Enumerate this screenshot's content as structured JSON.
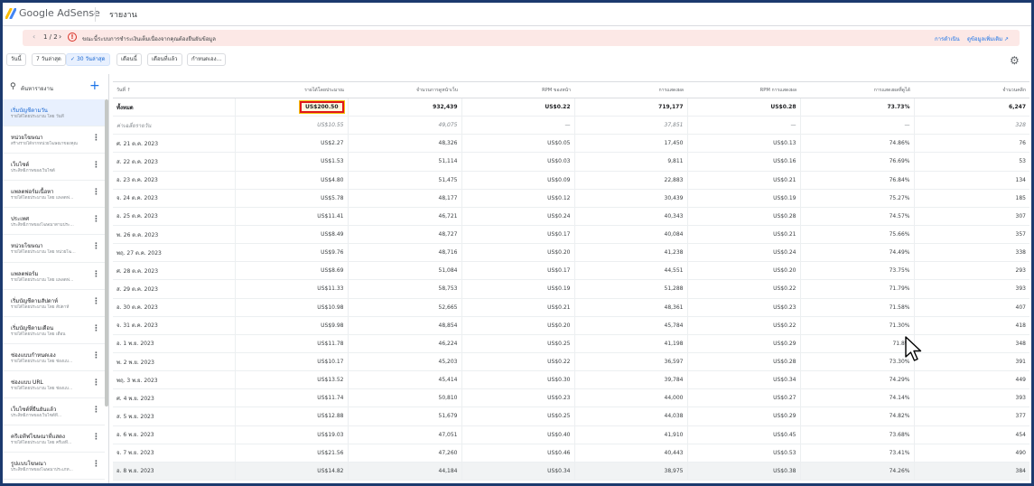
{
  "app": {
    "brand": "Google AdSense",
    "page_title": "รายงาน"
  },
  "alert": {
    "counter": "1 / 2",
    "message": "ขณะนี้ระบบการชำระเงินเต็มเนื่องจากคุณต้องยืนยันข้อมูล",
    "action_1": "การดำเนิน",
    "action_2": "ดูข้อมูลเพิ่มเติม ↗",
    "colors": {
      "background": "#fce8e6",
      "icon": "#d93025",
      "link": "#1a73e8"
    }
  },
  "date_chips": [
    {
      "label": "วันนี้",
      "selected": false
    },
    {
      "label": "7 วันล่าสุด",
      "selected": false
    },
    {
      "label": "30 วันล่าสุด",
      "selected": true
    },
    {
      "label": "เดือนนี้",
      "selected": false
    },
    {
      "label": "เดือนที่แล้ว",
      "selected": false
    },
    {
      "label": "กำหนดเอง...",
      "selected": false
    }
  ],
  "sidebar": {
    "search_label": "ค้นหารายงาน",
    "add_icon": "plus-icon",
    "reports": [
      {
        "title": "เริ่มบัญชีตามวัน",
        "subtitle": "รายได้โดยประมาณ โดย วันที่",
        "active": true
      },
      {
        "title": "หน่วยโฆษณา",
        "subtitle": "สร้างรายได้จากหน่วยโฆษณาของคุณ",
        "active": false
      },
      {
        "title": "เว็บไซต์",
        "subtitle": "ประสิทธิภาพของเว็บไซต์",
        "active": false
      },
      {
        "title": "แพลตฟอร์มเนื้อหา",
        "subtitle": "รายได้โดยประมาณ โดย แพลตฟ...",
        "active": false
      },
      {
        "title": "ประเทศ",
        "subtitle": "ประสิทธิภาพของโฆษณาตามประ...",
        "active": false
      },
      {
        "title": "หน่วยโฆษณา",
        "subtitle": "รายได้โดยประมาณ โดย หน่วยโฆ...",
        "active": false
      },
      {
        "title": "แพลตฟอร์ม",
        "subtitle": "รายได้โดยประมาณ โดย แพลตฟ...",
        "active": false
      },
      {
        "title": "เริ่มบัญชีตามสัปดาห์",
        "subtitle": "รายได้โดยประมาณ โดย สัปดาห์",
        "active": false
      },
      {
        "title": "เริ่มบัญชีตามเดือน",
        "subtitle": "รายได้โดยประมาณ โดย เดือน",
        "active": false
      },
      {
        "title": "ช่องแบบกำหนดเอง",
        "subtitle": "รายได้โดยประมาณ โดย ช่องแบ...",
        "active": false
      },
      {
        "title": "ช่องแบบ URL",
        "subtitle": "รายได้โดยประมาณ โดย ช่องแบ...",
        "active": false
      },
      {
        "title": "เว็บไซต์ที่ยืนยันแล้ว",
        "subtitle": "ประสิทธิภาพของเว็บไซต์ที่...",
        "active": false
      },
      {
        "title": "ครีเอทีฟโฆษณาที่แสดง",
        "subtitle": "รายได้โดยประมาณ โดย ครีเอที...",
        "active": false
      },
      {
        "title": "รูปแบบโฆษณา",
        "subtitle": "ประสิทธิภาพของโฆษณาประเภท...",
        "active": false
      }
    ]
  },
  "table": {
    "columns": [
      "วันที่ ↑",
      "รายได้โดยประมาณ",
      "จำนวนการดูหน้าเว็บ",
      "RPM ของหน้า",
      "การแสดงผล",
      "RPM การแสดงผล",
      "การแสดงผลที่ดูได้",
      "จำนวนคลิก"
    ],
    "total": [
      "ทั้งหมด",
      "US$200.50",
      "932,439",
      "US$0.22",
      "719,177",
      "US$0.28",
      "73.73%",
      "6,247"
    ],
    "average": [
      "ค่าเฉลี่ยรายวัน",
      "US$10.55",
      "49,075",
      "—",
      "37,851",
      "—",
      "—",
      "328"
    ],
    "rows": [
      [
        "ศ. 21 ต.ค. 2023",
        "US$2.27",
        "48,326",
        "US$0.05",
        "17,450",
        "US$0.13",
        "74.86%",
        "76"
      ],
      [
        "ส. 22 ต.ค. 2023",
        "US$1.53",
        "51,114",
        "US$0.03",
        "9,811",
        "US$0.16",
        "76.69%",
        "53"
      ],
      [
        "อ. 23 ต.ค. 2023",
        "US$4.80",
        "51,475",
        "US$0.09",
        "22,883",
        "US$0.21",
        "76.84%",
        "134"
      ],
      [
        "จ. 24 ต.ค. 2023",
        "US$5.78",
        "48,177",
        "US$0.12",
        "30,439",
        "US$0.19",
        "75.27%",
        "185"
      ],
      [
        "อ. 25 ต.ค. 2023",
        "US$11.41",
        "46,721",
        "US$0.24",
        "40,343",
        "US$0.28",
        "74.57%",
        "307"
      ],
      [
        "พ. 26 ต.ค. 2023",
        "US$8.49",
        "48,727",
        "US$0.17",
        "40,084",
        "US$0.21",
        "75.66%",
        "357"
      ],
      [
        "พฤ. 27 ต.ค. 2023",
        "US$9.76",
        "48,716",
        "US$0.20",
        "41,238",
        "US$0.24",
        "74.49%",
        "338"
      ],
      [
        "ศ. 28 ต.ค. 2023",
        "US$8.69",
        "51,084",
        "US$0.17",
        "44,551",
        "US$0.20",
        "73.75%",
        "293"
      ],
      [
        "ส. 29 ต.ค. 2023",
        "US$11.33",
        "58,753",
        "US$0.19",
        "51,288",
        "US$0.22",
        "71.79%",
        "393"
      ],
      [
        "อ. 30 ต.ค. 2023",
        "US$10.98",
        "52,665",
        "US$0.21",
        "48,361",
        "US$0.23",
        "71.58%",
        "407"
      ],
      [
        "จ. 31 ต.ค. 2023",
        "US$9.98",
        "48,854",
        "US$0.20",
        "45,784",
        "US$0.22",
        "71.30%",
        "418"
      ],
      [
        "อ. 1 พ.ย. 2023",
        "US$11.78",
        "46,224",
        "US$0.25",
        "41,198",
        "US$0.29",
        "71.8%",
        "348"
      ],
      [
        "พ. 2 พ.ย. 2023",
        "US$10.17",
        "45,203",
        "US$0.22",
        "36,597",
        "US$0.28",
        "73.30%",
        "391"
      ],
      [
        "พฤ. 3 พ.ย. 2023",
        "US$13.52",
        "45,414",
        "US$0.30",
        "39,784",
        "US$0.34",
        "74.29%",
        "449"
      ],
      [
        "ศ. 4 พ.ย. 2023",
        "US$11.74",
        "50,810",
        "US$0.23",
        "44,000",
        "US$0.27",
        "74.14%",
        "393"
      ],
      [
        "ส. 5 พ.ย. 2023",
        "US$12.88",
        "51,679",
        "US$0.25",
        "44,038",
        "US$0.29",
        "74.82%",
        "377"
      ],
      [
        "อ. 6 พ.ย. 2023",
        "US$19.03",
        "47,051",
        "US$0.40",
        "41,910",
        "US$0.45",
        "73.68%",
        "454"
      ],
      [
        "จ. 7 พ.ย. 2023",
        "US$21.56",
        "47,260",
        "US$0.46",
        "40,443",
        "US$0.53",
        "73.41%",
        "490"
      ],
      [
        "อ. 8 พ.ย. 2023",
        "US$14.82",
        "44,184",
        "US$0.34",
        "38,975",
        "US$0.38",
        "74.26%",
        "384"
      ]
    ],
    "highlight_color": "#e0171a"
  },
  "icons": {
    "settings": "gear-icon",
    "search": "search-icon",
    "more": "more-vert-icon",
    "error": "error-icon",
    "cursor": "mouse-pointer-icon"
  }
}
